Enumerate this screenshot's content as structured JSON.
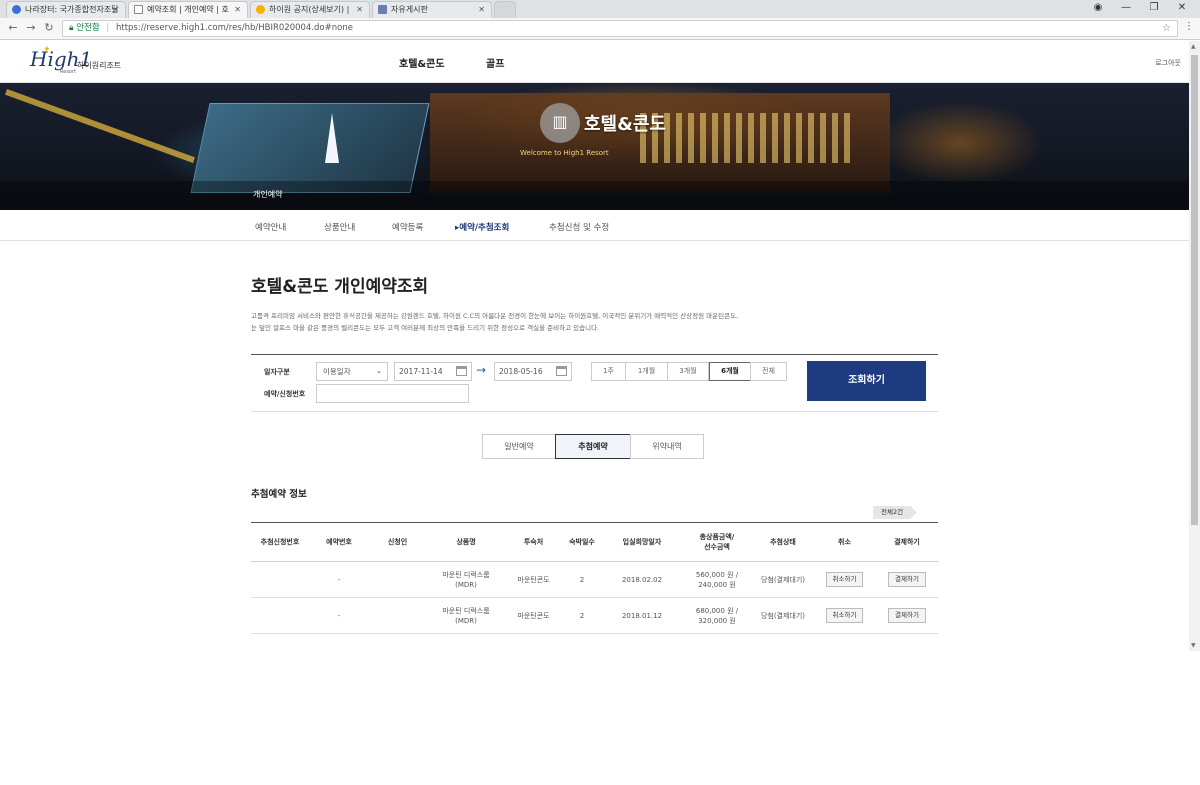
{
  "browser": {
    "tabs": [
      {
        "title": "나라장터: 국가종합전자조달",
        "fav_color": "#3a6fd6"
      },
      {
        "title": "예약조회 | 개인예약 | 호",
        "fav_color": "#888888"
      },
      {
        "title": "하이원 공지(상세보기) |",
        "fav_color": "#f3b200"
      },
      {
        "title": "자유게시판",
        "fav_color": "#6a7fb0"
      }
    ],
    "secure_label": "안전함",
    "url": "https://reserve.high1.com/res/hb/HBIR020004.do#none"
  },
  "site": {
    "logo_text": "High1",
    "logo_sub": "Resort",
    "logo_ko": "하이원리조트",
    "gnb": [
      "호텔&콘도",
      "골프"
    ],
    "logout": "로그아웃"
  },
  "hero": {
    "title": "호텔&콘도",
    "sub": "Welcome to High1 Resort",
    "crumb": "개인예약"
  },
  "subnav": [
    "예약안내",
    "상품안내",
    "예약등록",
    "▸예약/추첨조회",
    "추첨신청 및 수정"
  ],
  "page": {
    "title": "호텔&콘도 개인예약조회",
    "desc_line1": "고품격 프리미엄 서비스와 편안한 휴식공간을 제공하는 강원랜드 호텔, 하이원 C.C의 아름다운 전경이 한눈에 보이는 하이원호텔, 이국적인 분위기가 매력적인 산상정원 마운틴콘도,",
    "desc_line2": "눈 덮인 알프스 마을 같은 풍경의 밸리콘도는 모두 고객 여러분께 최상의 만족을 드리기 위한 정성으로 객실을 준비하고 있습니다."
  },
  "search": {
    "date_label": "일자구분",
    "date_type": "이용일자",
    "date_from": "2017-11-14",
    "date_to": "2018-05-16",
    "periods": [
      "1주",
      "1개월",
      "3개월",
      "6개월",
      "전체"
    ],
    "active_period": "6개월",
    "resno_label": "예약/신청번호",
    "resno_value": "",
    "button": "조회하기"
  },
  "segments": [
    "일반예약",
    "추첨예약",
    "위약내역"
  ],
  "active_segment": "추첨예약",
  "section": {
    "title": "추첨예약 정보",
    "count": "전체2건"
  },
  "table": {
    "headers": [
      "추첨신청번호",
      "예약번호",
      "신청인",
      "상품명",
      "투숙처",
      "숙박일수",
      "입실희망일자",
      "총상품금액/\n선수금액",
      "추첨상태",
      "취소",
      "결제하기"
    ],
    "rows": [
      {
        "apply_no": "",
        "res_no": "-",
        "applicant": "",
        "product_1": "마운틴 디럭스룸",
        "product_2": "(MDR)",
        "place": "마운틴콘도",
        "nights": "2",
        "checkin": "2018.02.02",
        "total": "560,000 원 /",
        "deposit": "240,000 원",
        "status": "당첨(결제대기)",
        "cancel": "취소하기",
        "pay": "결제하기"
      },
      {
        "apply_no": "",
        "res_no": "-",
        "applicant": "",
        "product_1": "마운틴 디럭스룸",
        "product_2": "(MDR)",
        "place": "마운틴콘도",
        "nights": "2",
        "checkin": "2018.01.12",
        "total": "680,000 원 /",
        "deposit": "320,000 원",
        "status": "당첨(결제대기)",
        "cancel": "취소하기",
        "pay": "결제하기"
      }
    ]
  },
  "colors": {
    "primary": "#1e3b82",
    "active_nav": "#1e3770"
  }
}
